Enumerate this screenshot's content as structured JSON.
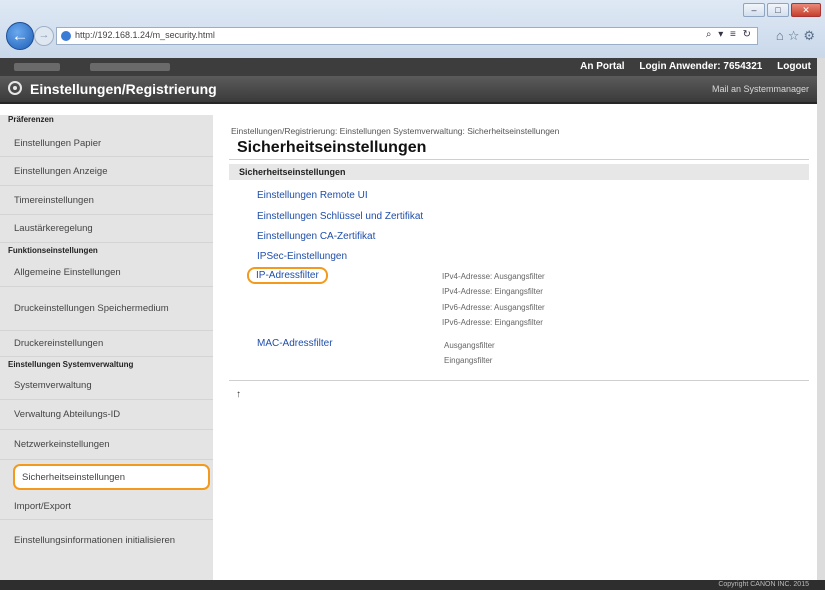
{
  "browser": {
    "url": "http://192.168.1.24/m_security.html",
    "tools": "⌕ ▾ ≡ ↻",
    "minimize": "–",
    "maximize": "□",
    "close": "✕",
    "icons": [
      "home-icon",
      "star-icon",
      "gear-icon"
    ]
  },
  "topbar": {
    "portal": "An Portal",
    "login_user": "Login Anwender: 7654321",
    "logout": "Logout"
  },
  "header": {
    "title": "Einstellungen/Registrierung",
    "mail_admin": "Mail an Systemmanager"
  },
  "sidebar": {
    "items": [
      {
        "type": "header",
        "label": "Präferenzen"
      },
      {
        "type": "item",
        "label": "Einstellungen Papier"
      },
      {
        "type": "item",
        "label": "Einstellungen Anzeige"
      },
      {
        "type": "item",
        "label": "Timereinstellungen"
      },
      {
        "type": "item",
        "label": "Laustärkeregelung"
      },
      {
        "type": "header",
        "label": "Funktionseinstellungen"
      },
      {
        "type": "item",
        "label": "Allgemeine Einstellungen"
      },
      {
        "type": "item",
        "label": "Druckeinstellungen Speichermedium"
      },
      {
        "type": "item",
        "label": "Druckereinstellungen"
      },
      {
        "type": "header",
        "label": "Einstellungen Systemverwaltung"
      },
      {
        "type": "item",
        "label": "Systemverwaltung"
      },
      {
        "type": "item",
        "label": "Verwaltung Abteilungs-ID"
      },
      {
        "type": "item",
        "label": "Netzwerkeinstellungen"
      },
      {
        "type": "item",
        "label": "Sicherheitseinstellungen",
        "active": true
      },
      {
        "type": "item",
        "label": "Import/Export"
      },
      {
        "type": "item",
        "label": "Einstellungsinformationen initialisieren"
      }
    ]
  },
  "main": {
    "breadcrumb": "Einstellungen/Registrierung: Einstellungen Systemverwaltung: Sicherheitseinstellungen",
    "title": "Sicherheitseinstellungen",
    "section": "Sicherheitseinstellungen",
    "links": {
      "remote_ui": "Einstellungen Remote UI",
      "key_cert": "Einstellungen Schlüssel und Zertifikat",
      "ca_cert": "Einstellungen CA-Zertifikat",
      "ipsec": "IPSec-Einstellungen",
      "ip_filter": "IP-Adressfilter",
      "mac_filter": "MAC-Adressfilter"
    },
    "ip_filter_notes": [
      "IPv4-Adresse: Ausgangsfilter",
      "IPv4-Adresse: Eingangsfilter",
      "IPv6-Adresse: Ausgangsfilter",
      "IPv6-Adresse: Eingangsfilter"
    ],
    "mac_filter_notes": [
      "Ausgangsfilter",
      "Eingangsfilter"
    ],
    "top_icon": "↑"
  },
  "footer": {
    "copyright": "Copyright CANON INC. 2015"
  },
  "colors": {
    "highlight": "#f39a1d",
    "link": "#1f4eaa"
  }
}
